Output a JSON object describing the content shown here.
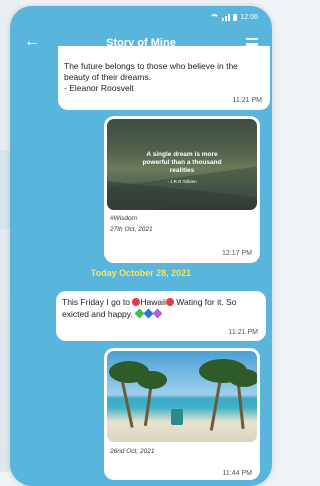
{
  "status": {
    "time": "12:06"
  },
  "appbar": {
    "title": "Story of Mine"
  },
  "quote_message": {
    "text": "The future belongs to those who believe in the beauty of their dreams.\n- Eleanor Roosvelt",
    "time": "11:21 PM"
  },
  "image_message_1": {
    "overlay_quote": "A single dream is more powerful than a thousand realities",
    "overlay_author": "- J.R.R.Tolkien",
    "tag": "#Wisdom",
    "date": "27th Oct, 2021",
    "time": "12:17 PM"
  },
  "date_divider": "Today October 28, 2021",
  "text_message": {
    "part1": "This Friday I go to",
    "part2": "Hawaii",
    "part3": "Wating for it. So exicted and happy.",
    "time": "11:21 PM",
    "heart_colors": [
      "#3fbf3f",
      "#2f6fe0",
      "#b35ee0"
    ]
  },
  "image_message_2": {
    "date": "26nd Oct, 2021",
    "time": "11:44 PM"
  }
}
